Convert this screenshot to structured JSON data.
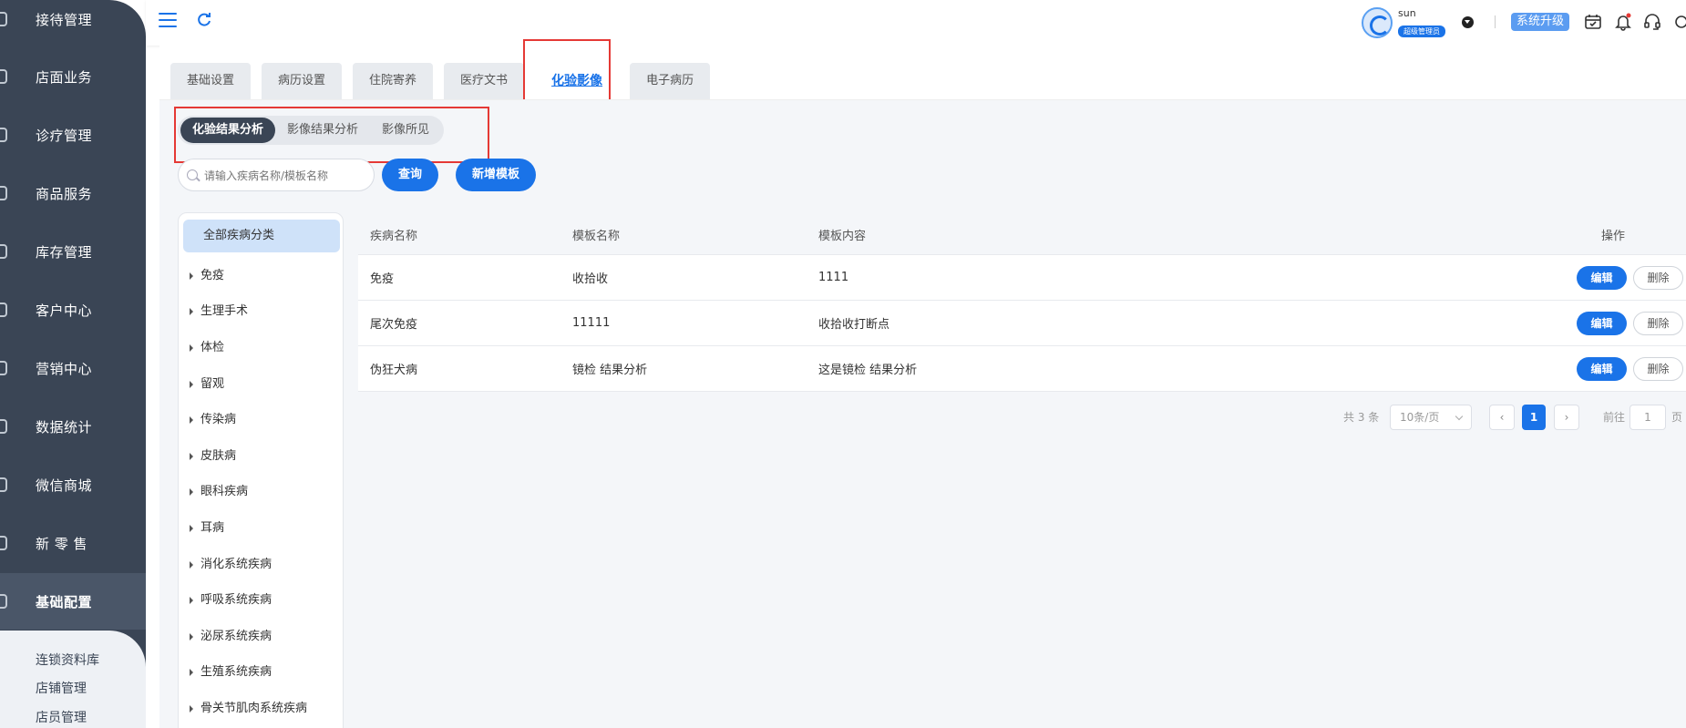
{
  "sidebar": {
    "items": [
      {
        "label": "接待管理",
        "icon": "reception-icon"
      },
      {
        "label": "店面业务",
        "icon": "store-icon"
      },
      {
        "label": "诊疗管理",
        "icon": "diagnosis-icon"
      },
      {
        "label": "商品服务",
        "icon": "goods-icon"
      },
      {
        "label": "库存管理",
        "icon": "inventory-icon"
      },
      {
        "label": "客户中心",
        "icon": "customer-icon"
      },
      {
        "label": "营销中心",
        "icon": "marketing-icon"
      },
      {
        "label": "数据统计",
        "icon": "statistics-icon"
      },
      {
        "label": "微信商城",
        "icon": "wechat-mall-icon"
      },
      {
        "label": "新 零 售",
        "icon": "retail-icon"
      },
      {
        "label": "基础配置",
        "icon": "settings-icon"
      }
    ],
    "active_index": 10,
    "sub_items": [
      "连锁资料库",
      "店铺管理",
      "店员管理"
    ]
  },
  "header": {
    "user_name": "sun",
    "user_role": "超级管理员",
    "upgrade_label": "系统升级"
  },
  "tabs": [
    "基础设置",
    "病历设置",
    "住院寄养",
    "医疗文书",
    "化验影像",
    "电子病历"
  ],
  "active_tab": 4,
  "subtabs": [
    "化验结果分析",
    "影像结果分析",
    "影像所见"
  ],
  "active_subtab": 0,
  "search": {
    "placeholder": "请输入疾病名称/模板名称",
    "query_label": "查询",
    "add_label": "新增模板"
  },
  "tree": {
    "all_label": "全部疾病分类",
    "items": [
      "免疫",
      "生理手术",
      "体检",
      "留观",
      "传染病",
      "皮肤病",
      "眼科疾病",
      "耳病",
      "消化系统疾病",
      "呼吸系统疾病",
      "泌尿系统疾病",
      "生殖系统疾病",
      "骨关节肌肉系统疾病"
    ]
  },
  "table": {
    "headers": [
      "疾病名称",
      "模板名称",
      "模板内容",
      "操作"
    ],
    "rows": [
      {
        "disease": "免疫",
        "template": "收拾收",
        "content": "1111"
      },
      {
        "disease": "尾次免疫",
        "template": "11111",
        "content": "收拾收打断点"
      },
      {
        "disease": "伪狂犬病",
        "template": "镜检 结果分析",
        "content": "这是镜检 结果分析"
      }
    ],
    "edit_label": "编辑",
    "delete_label": "删除"
  },
  "pagination": {
    "total": "共 3 条",
    "page_size": "10条/页",
    "current": "1",
    "goto_label": "前往",
    "goto_value": "1",
    "unit": "页"
  },
  "colors": {
    "accent": "#1a73e8",
    "sidebar": "#3a4555",
    "highlight": "#e53935"
  }
}
